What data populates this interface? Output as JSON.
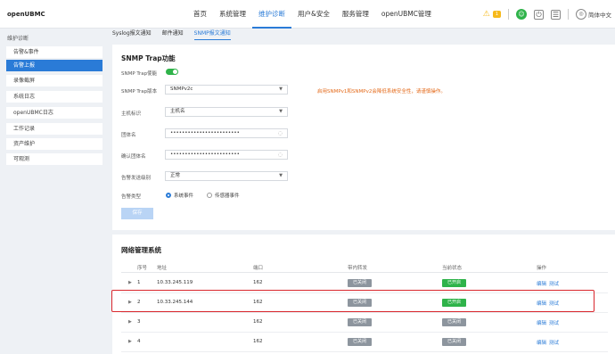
{
  "header": {
    "logo": "openUBMC",
    "nav": [
      "首页",
      "系统管理",
      "维护诊断",
      "用户&安全",
      "服务管理",
      "openUBMC管理"
    ],
    "active_nav": 2,
    "alert_count": "1",
    "language": "简体中文"
  },
  "sidebar": {
    "title": "维护诊断",
    "items": [
      "告警&事件",
      "告警上报",
      "录像截屏",
      "系统日志",
      "openUBMC日志",
      "工作记录",
      "资产维护",
      "可观测"
    ],
    "active": 1
  },
  "subtabs": [
    "Syslog报文通知",
    "邮件通知",
    "SNMP报文通知"
  ],
  "trap": {
    "title": "SNMP Trap功能",
    "enable_label": "SNMP Trap使能",
    "version_label": "SNMP Trap版本",
    "version_value": "SNMPv2c",
    "warning": "启用SNMPv1和SNMPv2会降低系统安全性，请谨慎操作。",
    "host_label": "主机标识",
    "host_value": "主机名",
    "community_label": "团体名",
    "community_value": "••••••••••••••••••••••••",
    "confirm_label": "确认团体名",
    "confirm_value": "••••••••••••••••••••••••",
    "level_label": "告警发送级别",
    "level_value": "正常",
    "type_label": "告警类型",
    "type_option1": "系统事件",
    "type_option2": "传感器事件",
    "save": "保存"
  },
  "nms": {
    "title": "网络管理系统",
    "columns": [
      "序号",
      "地址",
      "端口",
      "带内转发",
      "当前状态",
      "操作"
    ],
    "rows": [
      {
        "id": "1",
        "addr": "10.33.245.119",
        "port": "162",
        "inband": "已关闭",
        "status": "已开启",
        "edit": "编辑",
        "test": "测试"
      },
      {
        "id": "2",
        "addr": "10.33.245.144",
        "port": "162",
        "inband": "已关闭",
        "status": "已开启",
        "edit": "编辑",
        "test": "测试"
      },
      {
        "id": "3",
        "addr": "",
        "port": "162",
        "inband": "已关闭",
        "status": "已关闭",
        "edit": "编辑",
        "test": "测试"
      },
      {
        "id": "4",
        "addr": "",
        "port": "162",
        "inband": "已关闭",
        "status": "已关闭",
        "edit": "编辑",
        "test": "测试"
      }
    ]
  },
  "colors": {
    "accent": "#2a7bd7",
    "on": "#2fb34a",
    "off": "#8d959e",
    "warning": "#e46a1a",
    "highlight": "#d9262c"
  }
}
